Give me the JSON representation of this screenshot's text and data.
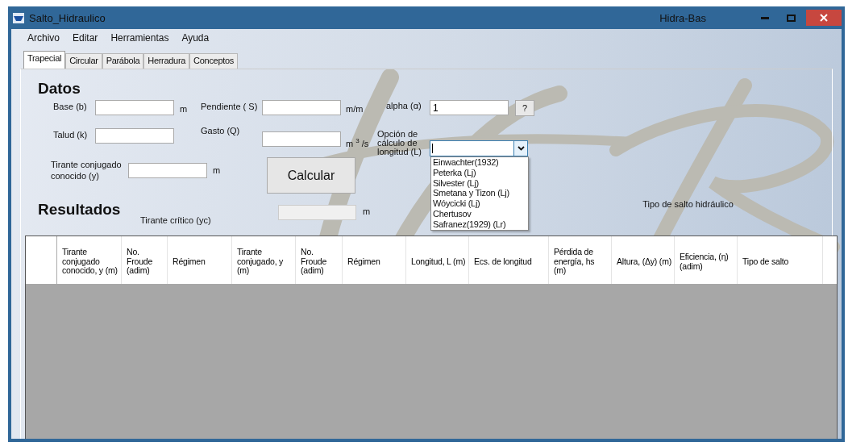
{
  "window": {
    "title": "Salto_Hidraulico",
    "app_name": "Hidra-Bas"
  },
  "menu": [
    "Archivo",
    "Editar",
    "Herramientas",
    "Ayuda"
  ],
  "tabs": [
    {
      "label": "Trapecial",
      "selected": true
    },
    {
      "label": "Circular",
      "selected": false
    },
    {
      "label": "Parábola",
      "selected": false
    },
    {
      "label": "Herradura",
      "selected": false
    },
    {
      "label": "Conceptos",
      "selected": false
    }
  ],
  "datos": {
    "heading": "Datos",
    "base": {
      "label": "Base (b)",
      "unit": "m"
    },
    "pendiente": {
      "label": "Pendiente ( S)",
      "unit": "m/m"
    },
    "alpha": {
      "label": "alpha  (α)",
      "value": "1",
      "help_button": "?"
    },
    "talud": {
      "label": "Talud (k)"
    },
    "gasto": {
      "label": "Gasto (Q)",
      "unit": "m $^{3}$ /s"
    },
    "length_option": {
      "label": "Opción de cálculo de longitud (L)",
      "expanded": true,
      "options": [
        "Einwachter(1932)",
        "Peterka (Lj)",
        "Silvester (Lj)",
        "Smetana y Tizon (Lj)",
        "Wóycicki (Lj)",
        "Chertusov",
        "Safranez(1929) (Lr)"
      ]
    },
    "tirante": {
      "label": "Tirante conjugado conocido   (y)",
      "unit": "m"
    },
    "calculate_button": "Calcular"
  },
  "resultados": {
    "heading": "Resultados",
    "critico": {
      "label": "Tirante  crítico (yc)",
      "unit": "m",
      "disabled": true
    },
    "tipo_label": "Tipo de salto hidráulico"
  },
  "table": {
    "columns": [
      "Tirante conjugado conocido, y (m)",
      "No. Froude (adim)",
      "Régimen",
      "Tirante conjugado, y (m)",
      "No. Froude (adim)",
      "Régimen",
      "Longitud, L (m)",
      "Ecs. de longitud",
      "Pérdida de energía, hs (m)",
      "Altura, (Δy) (m)",
      "Eficiencia, (η) (adim)",
      "Tipo de salto"
    ]
  }
}
